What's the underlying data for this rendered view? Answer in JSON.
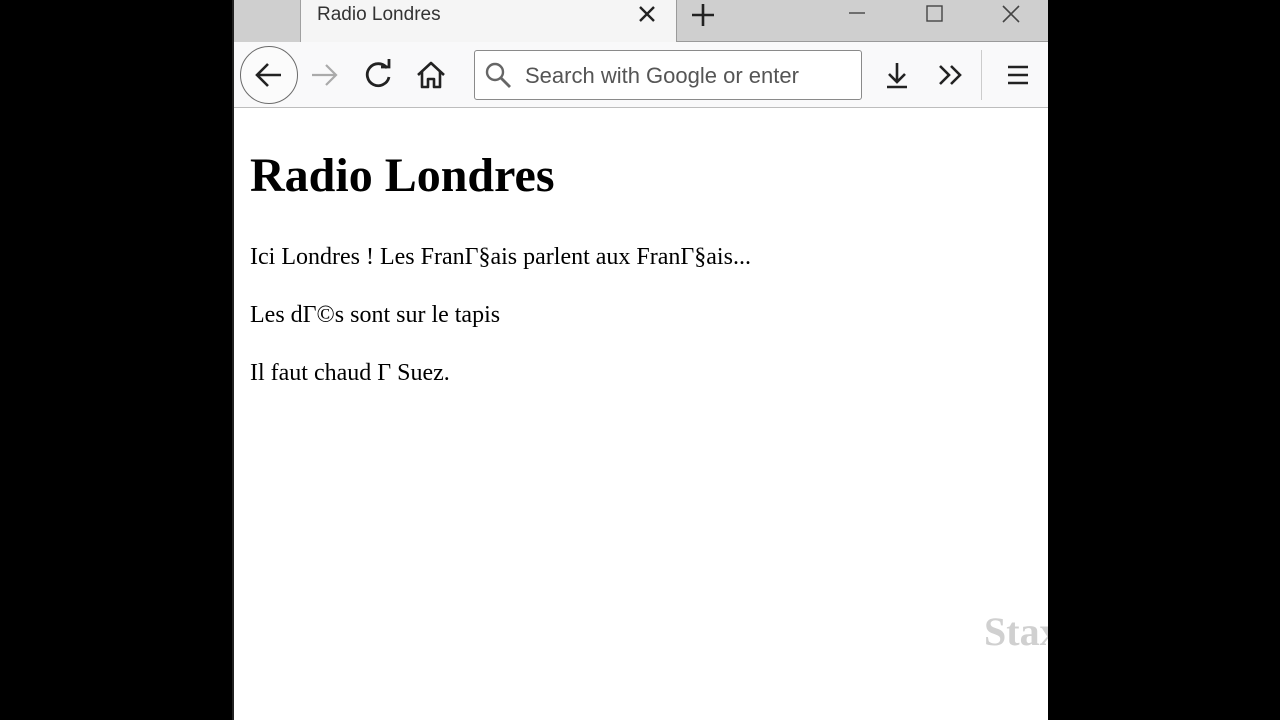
{
  "tab": {
    "title": "Radio Londres"
  },
  "toolbar": {
    "search_placeholder": "Search with Google or enter"
  },
  "page": {
    "heading": "Radio Londres",
    "paragraphs": [
      "Ici Londres ! Les FranΓ§ais parlent aux FranΓ§ais...",
      "Les dΓ©s sont sur le tapis",
      "Il faut chaud Γ  Suez."
    ],
    "watermark": "Stax"
  }
}
